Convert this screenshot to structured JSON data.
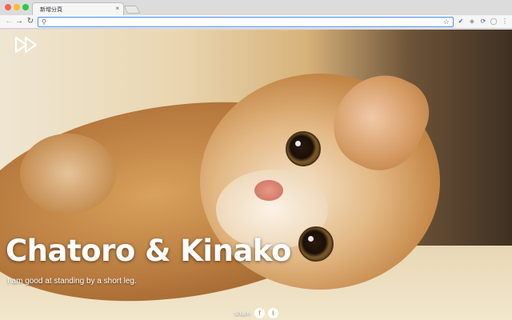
{
  "browser": {
    "tab_title": "新增分頁",
    "tab_close": "×",
    "nav": {
      "back": "←",
      "forward": "→",
      "reload": "↻"
    },
    "omnibox": {
      "search_glyph": "⚲",
      "star": "☆",
      "value": ""
    },
    "extensions": [
      "extension-v-icon",
      "extension-layers-icon",
      "extension-sync-icon",
      "extension-circle-icon",
      "menu-dots-icon"
    ],
    "extension_glyphs": [
      "✓",
      "◈",
      "⟳",
      "◯",
      "⋮"
    ]
  },
  "page": {
    "logo_icon": "fast-forward-icon",
    "headline": "Chatoro & Kinako",
    "tagline": "I am good at standing by a short leg.",
    "share": {
      "label": "share",
      "facebook_glyph": "f",
      "twitter_glyph": "t"
    }
  },
  "colors": {
    "omnibox_border": "#4d90fe",
    "headline_text": "#ffffff",
    "fur_orange": "#c48747"
  }
}
